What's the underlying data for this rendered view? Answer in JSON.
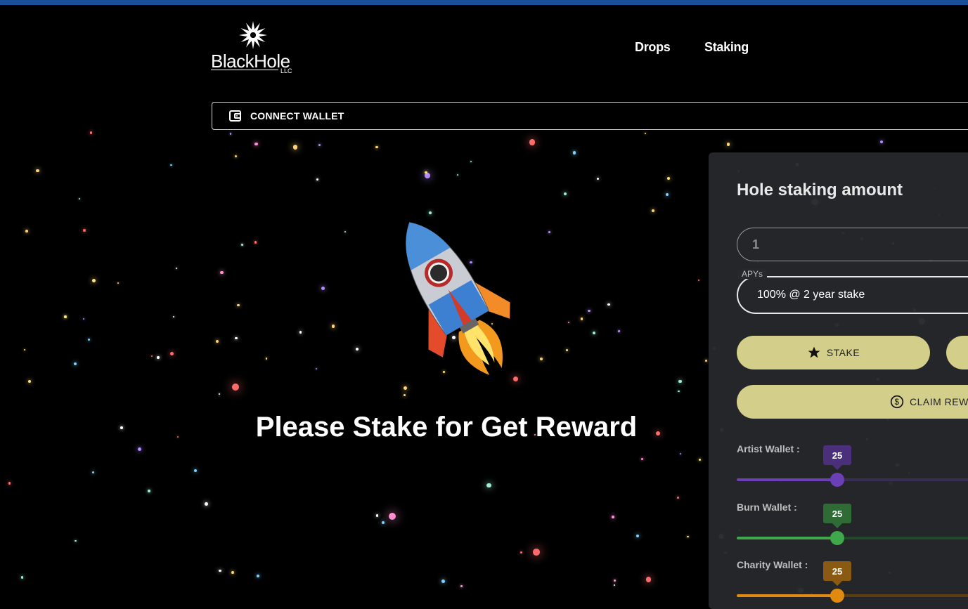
{
  "brand": {
    "name": "BlackHole",
    "suffix": "LLC"
  },
  "nav": {
    "drops": "Drops",
    "staking": "Staking"
  },
  "wallet": {
    "connect_label": "CONNECT WALLET"
  },
  "hero": {
    "message": "Please Stake for Get Reward"
  },
  "staking": {
    "title": "Hole staking amount",
    "amount_value": "1",
    "apy_label": "APYs",
    "apy_value": "100% @ 2 year stake",
    "stake_label": "STAKE",
    "claim_label": "CLAIM REWA"
  },
  "sliders": [
    {
      "label": "Artist Wallet :",
      "value": "25",
      "color": "#6b3fb5"
    },
    {
      "label": "Burn Wallet :",
      "value": "25",
      "color": "#3ea84a"
    },
    {
      "label": "Charity Wallet :",
      "value": "25",
      "color": "#e08a10"
    }
  ],
  "colors": {
    "topbar": "#1b4f9c",
    "button": "#d3cf8a"
  }
}
